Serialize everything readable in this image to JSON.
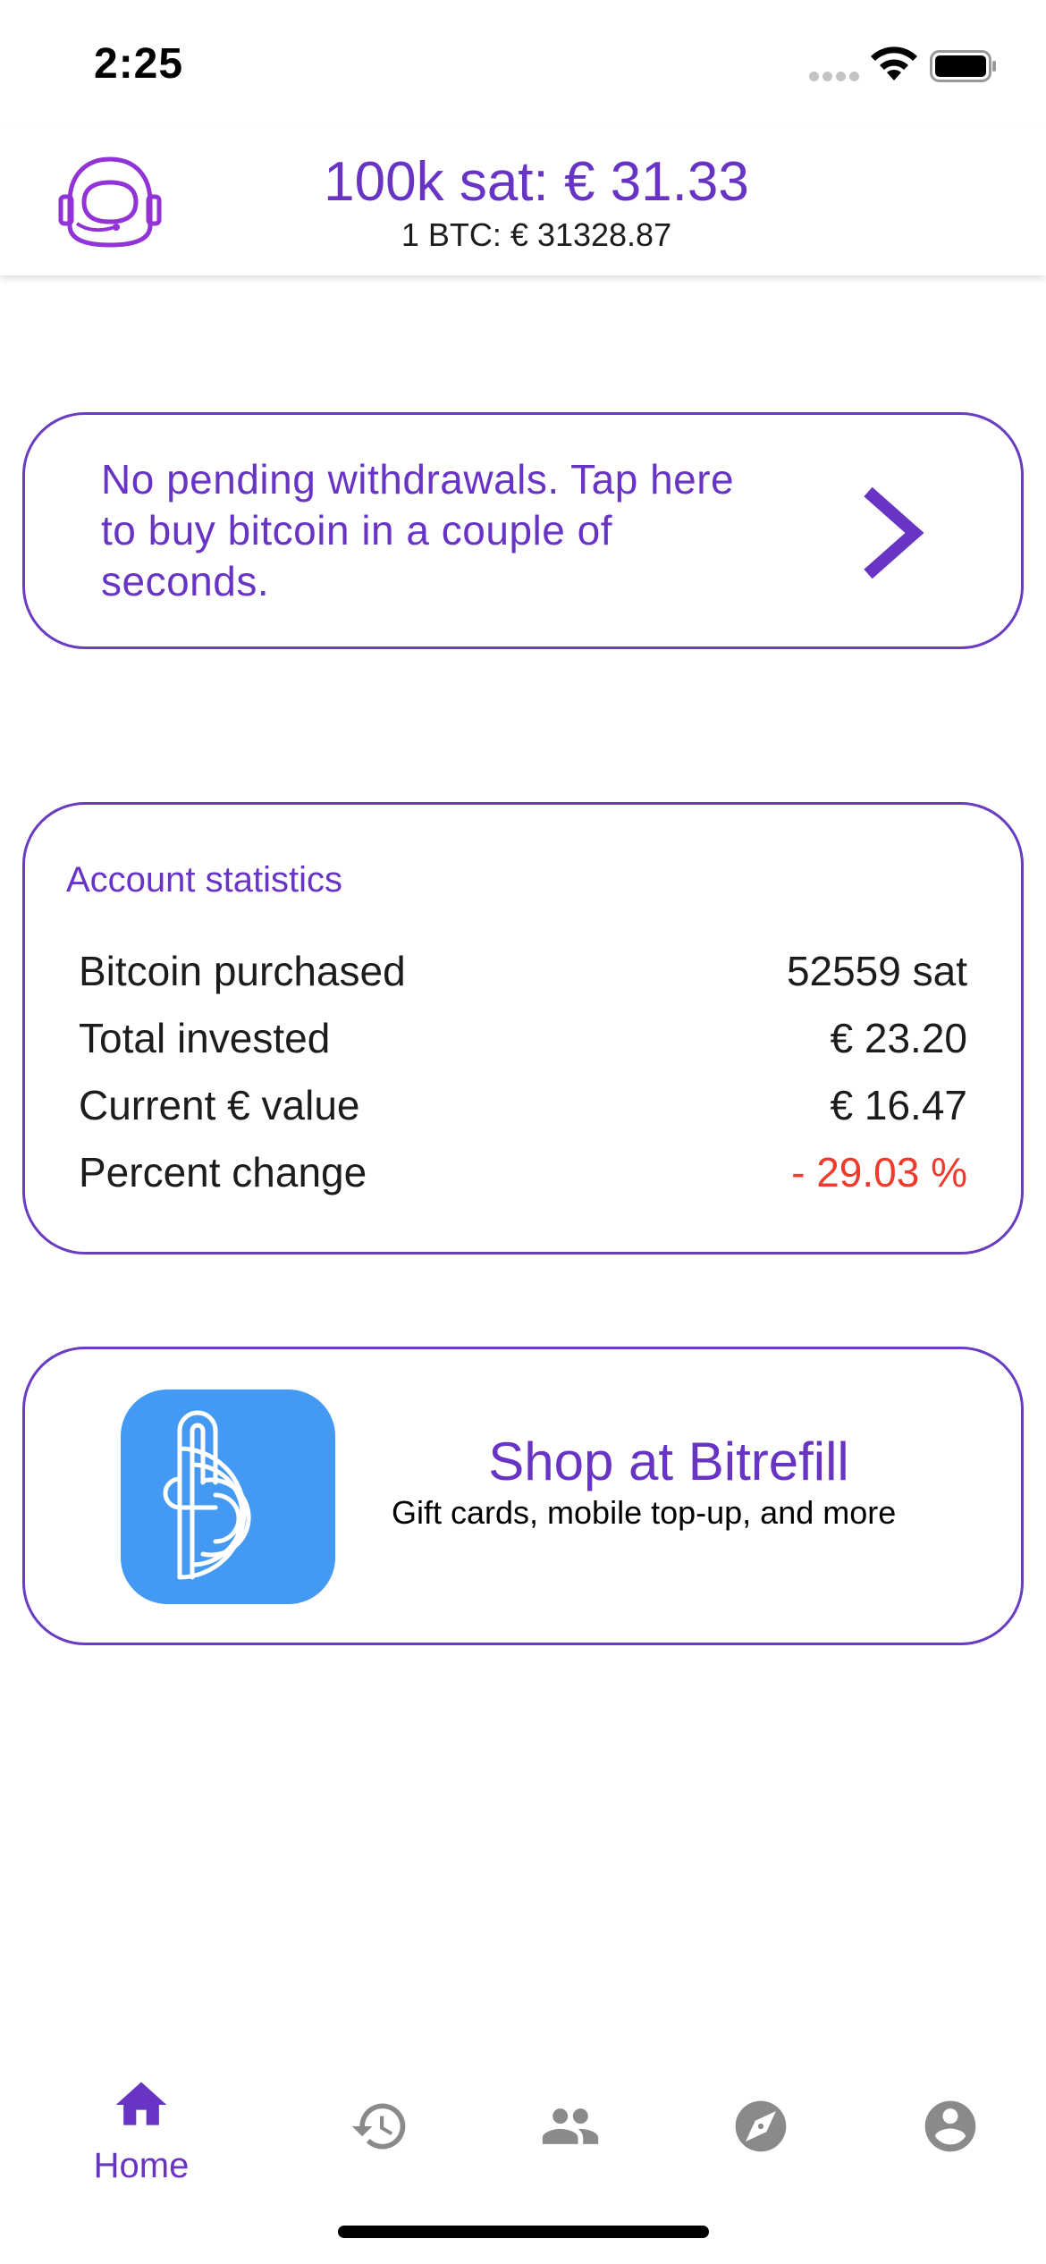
{
  "status_bar": {
    "time": "2:25"
  },
  "header": {
    "main_rate": "100k sat: € 31.33",
    "sub_rate": "1 BTC: € 31328.87",
    "avatar_icon": "astronaut-helmet-icon"
  },
  "withdrawals_card": {
    "text": "No pending withdrawals. Tap here to buy bitcoin in a couple of seconds.",
    "icon": "chevron-right-icon"
  },
  "account_stats": {
    "title": "Account statistics",
    "rows": [
      {
        "label": "Bitcoin purchased",
        "value": "52559 sat"
      },
      {
        "label": "Total invested",
        "value": "€ 23.20"
      },
      {
        "label": "Current € value",
        "value": "€ 16.47"
      },
      {
        "label": "Percent change",
        "value": "- 29.03 %"
      }
    ]
  },
  "shop_card": {
    "title": "Shop at Bitrefill",
    "subtitle": "Gift cards, mobile top-up, and more",
    "logo_icon": "bitrefill-logo-icon"
  },
  "bottom_nav": {
    "items": [
      {
        "label": "Home",
        "icon": "home-icon",
        "active": true
      },
      {
        "label": "",
        "icon": "history-icon",
        "active": false
      },
      {
        "label": "",
        "icon": "people-icon",
        "active": false
      },
      {
        "label": "",
        "icon": "compass-icon",
        "active": false
      },
      {
        "label": "",
        "icon": "account-circle-icon",
        "active": false
      }
    ]
  },
  "colors": {
    "accent": "#6834c4",
    "negative": "#ef3a2c",
    "inactive_icon": "#8a8a8a",
    "bitrefill_blue": "#4499f3"
  }
}
